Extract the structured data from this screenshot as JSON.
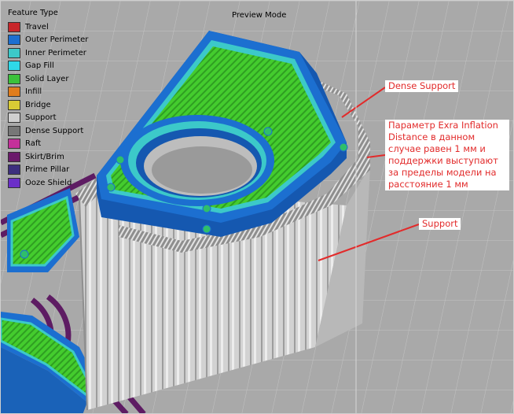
{
  "legend": {
    "title": "Feature Type",
    "items": [
      {
        "label": "Travel",
        "color": "#c8262a"
      },
      {
        "label": "Outer Perimeter",
        "color": "#1c6fd0"
      },
      {
        "label": "Inner Perimeter",
        "color": "#3cc9c9"
      },
      {
        "label": "Gap Fill",
        "color": "#2fd8e8"
      },
      {
        "label": "Solid Layer",
        "color": "#3bc23b"
      },
      {
        "label": "Infill",
        "color": "#e07d1e"
      },
      {
        "label": "Bridge",
        "color": "#d8cb35"
      },
      {
        "label": "Support",
        "color": "#cfcfcf"
      },
      {
        "label": "Dense Support",
        "color": "#777777"
      },
      {
        "label": "Raft",
        "color": "#c4309a"
      },
      {
        "label": "Skirt/Brim",
        "color": "#6b1a6b"
      },
      {
        "label": "Prime Pillar",
        "color": "#3d2f7e"
      },
      {
        "label": "Ooze Shield",
        "color": "#6b2fc8"
      }
    ]
  },
  "header": {
    "mode": "Preview Mode"
  },
  "annotations": {
    "dense_support": "Dense Support",
    "parameter_note": "Параметр Exra Inflation Distance в данном случае равен 1 мм и поддержки выступают за пределы модели на расстояние 1 мм",
    "support": "Support"
  },
  "colors": {
    "annotation": "#e22b2b",
    "solid_layer": "#3bc23b",
    "outer_perimeter": "#1c6fd0",
    "inner_perimeter": "#3cc9c9",
    "support": "#cfcfcf",
    "dense_support": "#777777",
    "skirt": "#6b1a6b"
  }
}
